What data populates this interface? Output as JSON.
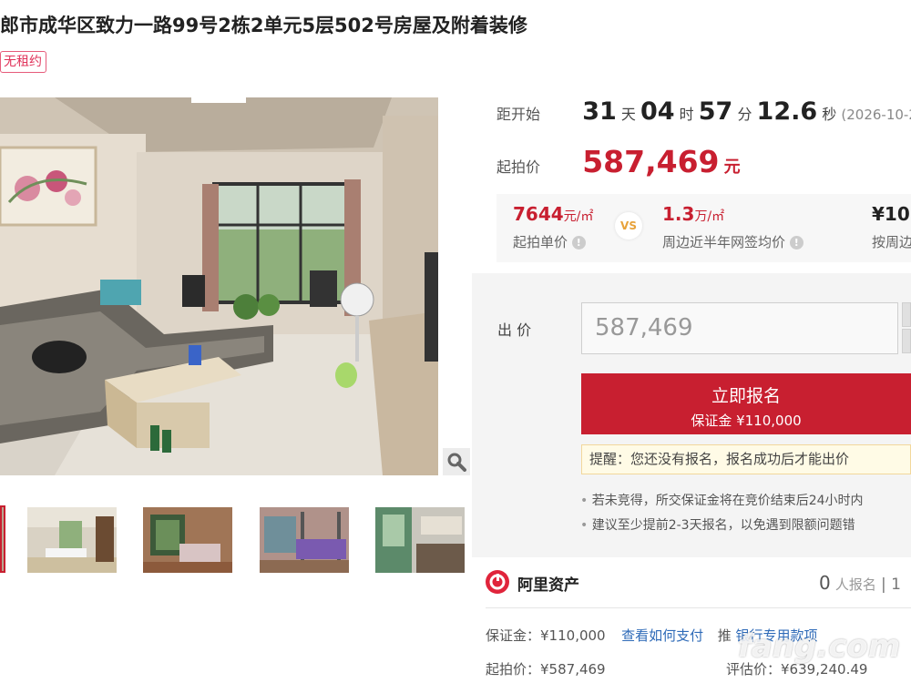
{
  "header": {
    "title": "郎市成华区致力一路99号2栋2单元5层502号房屋及附着装修",
    "badge": "无租约"
  },
  "countdown": {
    "label": "距开始",
    "days": "31",
    "days_unit": "天",
    "hours": "04",
    "hours_unit": "时",
    "minutes": "57",
    "minutes_unit": "分",
    "seconds": "12.6",
    "seconds_unit": "秒",
    "date_text": "(2026-10-2"
  },
  "starting_price": {
    "label": "起拍价",
    "value": "587,469",
    "unit": "元"
  },
  "price_compare": {
    "unit_price_value": "7644",
    "unit_price_unit": "元/㎡",
    "unit_price_label": "起拍单价",
    "vs": "VS",
    "area_avg_value": "1.3",
    "area_avg_unit": "万/㎡",
    "area_avg_label": "周边近半年网签均价",
    "third_value_prefix": "¥",
    "third_value": "10",
    "third_label": "按周边"
  },
  "bid": {
    "label": "出 价",
    "input_value": "587,469",
    "register_label": "立即报名",
    "deposit_text": "保证金 ¥110,000",
    "reminder": "提醒：您还没有报名，报名成功后才能出价",
    "notes": [
      "若未竞得，所交保证金将在竞价结束后24小时内",
      "建议至少提前2-3天报名，以免遇到限额问题错"
    ]
  },
  "provider": {
    "name": "阿里资产",
    "signup_count": "0",
    "signup_label": "人报名",
    "signup_sep": "| 1"
  },
  "details": {
    "deposit_label": "保证金：",
    "deposit_value": "¥110,000",
    "how_to_pay": "查看如何支付",
    "designated_prefix": "推",
    "designated_link": "银行专用款项",
    "start_label": "起拍价：",
    "start_value": "¥587,469",
    "eval_label": "评估价：",
    "eval_value": "¥639,240.49"
  },
  "watermark": "fang.com",
  "colors": {
    "accent": "#c81f30",
    "link": "#2f6bb8",
    "panel": "#f4f4f4"
  }
}
